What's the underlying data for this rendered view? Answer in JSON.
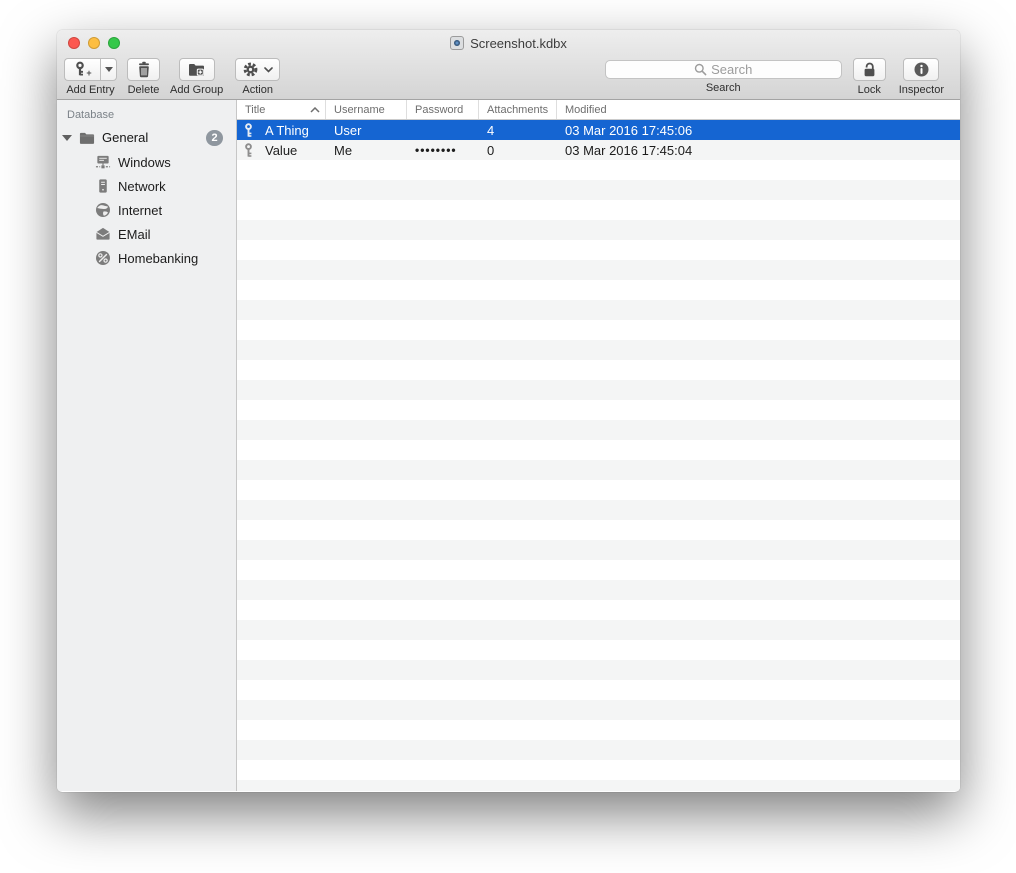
{
  "window": {
    "title": "Screenshot.kdbx"
  },
  "toolbar": {
    "add_entry_label": "Add Entry",
    "delete_label": "Delete",
    "add_group_label": "Add Group",
    "action_label": "Action",
    "search_placeholder": "Search",
    "search_label": "Search",
    "lock_label": "Lock",
    "inspector_label": "Inspector"
  },
  "sidebar": {
    "header": "Database",
    "group": {
      "label": "General",
      "badge": "2",
      "expanded": true
    },
    "items": [
      {
        "label": "Windows",
        "icon": "windows-icon"
      },
      {
        "label": "Network",
        "icon": "network-icon"
      },
      {
        "label": "Internet",
        "icon": "internet-icon"
      },
      {
        "label": "EMail",
        "icon": "email-icon"
      },
      {
        "label": "Homebanking",
        "icon": "homebanking-icon"
      }
    ]
  },
  "table": {
    "columns": [
      {
        "label": "Title",
        "sort": "asc"
      },
      {
        "label": "Username"
      },
      {
        "label": "Password"
      },
      {
        "label": "Attachments"
      },
      {
        "label": "Modified"
      }
    ],
    "rows": [
      {
        "title": "A Thing",
        "username": "User",
        "password": "",
        "attachments": "4",
        "modified": "03 Mar 2016 17:45:06",
        "selected": true
      },
      {
        "title": "Value",
        "username": "Me",
        "password": "••••••••",
        "attachments": "0",
        "modified": "03 Mar 2016 17:45:04",
        "selected": false
      }
    ]
  },
  "colors": {
    "selection": "#1565d2",
    "stripe": "#f4f5f5",
    "badge": "#8f979f",
    "traffic_red": "#fc5850",
    "traffic_yellow": "#fdbe41",
    "traffic_green": "#35c84a"
  }
}
